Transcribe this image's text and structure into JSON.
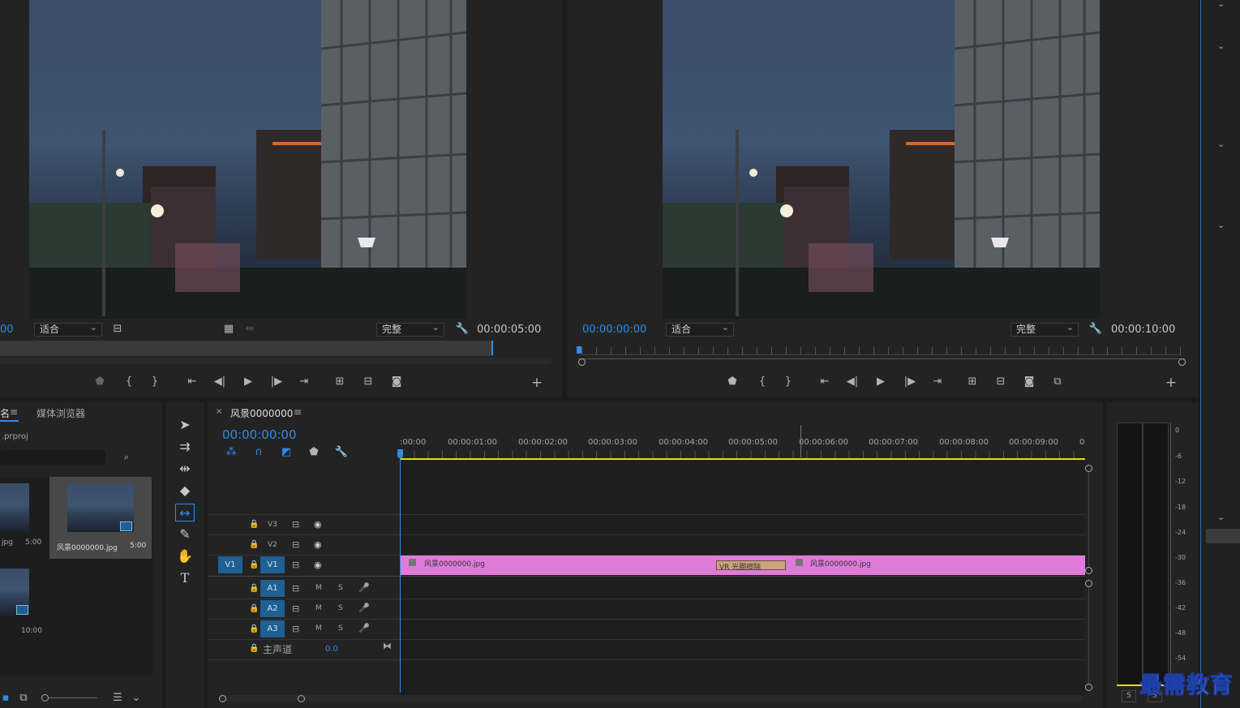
{
  "source_monitor": {
    "timecode_left": "00",
    "fit_label": "适合",
    "quality_label": "完整",
    "duration": "00:00:05:00"
  },
  "program_monitor": {
    "timecode": "00:00:00:00",
    "fit_label": "适合",
    "quality_label": "完整",
    "duration": "00:00:10:00"
  },
  "project": {
    "tab_partial": "名",
    "tab_media_browser": "媒体浏览器",
    "project_file": ".prproj",
    "items": [
      {
        "name": "jpg",
        "duration": "5:00"
      },
      {
        "name": "风景0000000.jpg",
        "duration": "5:00"
      },
      {
        "name": "",
        "duration": "10:00"
      }
    ]
  },
  "timeline": {
    "tab_title": "风景0000000",
    "timecode": "00:00:00:00",
    "ruler_labels": [
      ":00:00",
      "00:00:01:00",
      "00:00:02:00",
      "00:00:03:00",
      "00:00:04:00",
      "00:00:05:00",
      "00:00:06:00",
      "00:00:07:00",
      "00:00:08:00",
      "00:00:09:00",
      "0"
    ],
    "video_tracks": [
      "V3",
      "V2",
      "V1"
    ],
    "audio_tracks": [
      "A1",
      "A2",
      "A3"
    ],
    "source_patch": "V1",
    "mute_label": "M",
    "solo_label": "S",
    "master_label": "主声道",
    "master_value": "0.0",
    "clips": [
      {
        "name": "风景0000000.jpg"
      },
      {
        "name": "风景0000000.jpg"
      }
    ],
    "transition_label": "VR 光圈擦除"
  },
  "meter": {
    "scale": [
      "0",
      "-6",
      "-12",
      "-18",
      "-24",
      "-30",
      "-36",
      "-42",
      "-48",
      "-54"
    ],
    "solo_buttons": [
      "S",
      "S"
    ]
  },
  "watermark": "最需教育",
  "colors": {
    "accent_blue": "#2d8ceb",
    "clip_pink": "#e07ad9",
    "transition": "#c8a37c",
    "work_area_yellow": "#e9d71c",
    "track_target": "#1e5f94"
  }
}
